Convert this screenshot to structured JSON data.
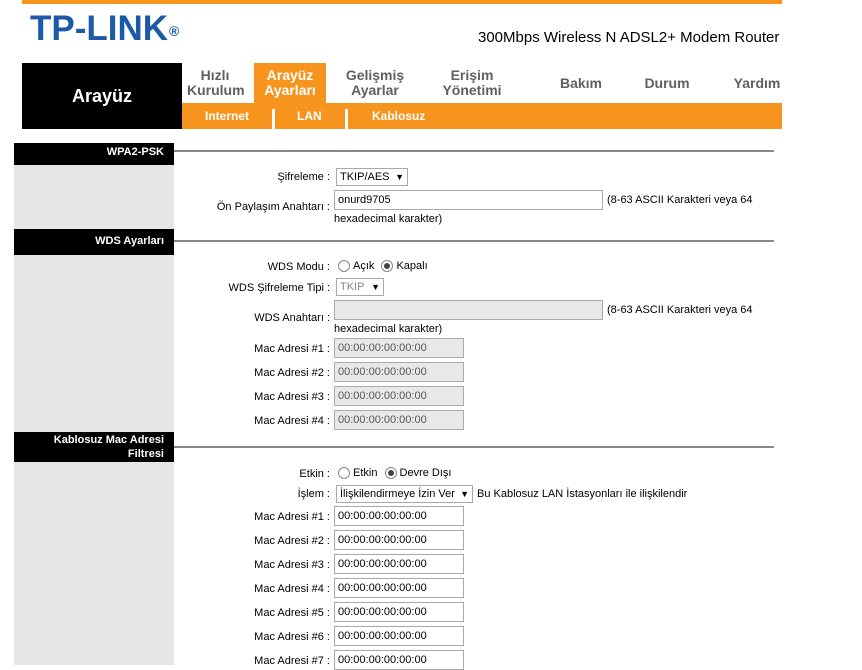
{
  "header": {
    "logo_text": "TP-LINK",
    "logo_reg": "®",
    "model": "300Mbps Wireless N ADSL2+ Modem Router",
    "accent_color": "#f7941d",
    "logo_color": "#1a5aa6"
  },
  "nav": {
    "section_title": "Arayüz",
    "items": [
      {
        "label": "Hızlı Kurulum"
      },
      {
        "label": "Arayüz Ayarları"
      },
      {
        "label": "Gelişmiş Ayarlar"
      },
      {
        "label": "Erişim Yönetimi"
      },
      {
        "label": "Bakım"
      },
      {
        "label": "Durum"
      },
      {
        "label": "Yardım"
      }
    ],
    "subitems": [
      {
        "label": "Internet"
      },
      {
        "label": "LAN"
      },
      {
        "label": "Kablosuz"
      }
    ]
  },
  "wpa": {
    "section": "WPA2-PSK",
    "encryption_label": "Şifreleme :",
    "encryption_value": "TKIP/AES",
    "psk_label": "Ön Paylaşım Anahtarı :",
    "psk_value": "onurd9705",
    "psk_note_line1": "(8-63 ASCII Karakteri veya 64",
    "psk_note_line2": "hexadecimal karakter)"
  },
  "wds": {
    "section": "WDS Ayarları",
    "mode_label": "WDS Modu :",
    "mode_on": "Açık",
    "mode_off": "Kapalı",
    "enc_label": "WDS Şifreleme Tipi :",
    "enc_value": "TKIP",
    "key_label": "WDS Anahtarı :",
    "key_value": "",
    "key_note_line1": "(8-63 ASCII Karakteri veya 64",
    "key_note_line2": "hexadecimal karakter)",
    "macs": [
      {
        "label": "Mac Adresi #1 :",
        "value": "00:00:00:00:00:00"
      },
      {
        "label": "Mac Adresi #2 :",
        "value": "00:00:00:00:00:00"
      },
      {
        "label": "Mac Adresi #3 :",
        "value": "00:00:00:00:00:00"
      },
      {
        "label": "Mac Adresi #4 :",
        "value": "00:00:00:00:00:00"
      }
    ]
  },
  "macfilter": {
    "section_line1": "Kablosuz Mac Adresi",
    "section_line2": "Filtresi",
    "active_label": "Etkin :",
    "active_on": "Etkin",
    "active_off": "Devre Dışı",
    "action_label": "İşlem :",
    "action_value": "İlişkilendirmeye İzin Ver",
    "action_note": "Bu Kablosuz LAN İstasyonları ile ilişkilendir",
    "macs": [
      {
        "label": "Mac Adresi #1 :",
        "value": "00:00:00:00:00:00"
      },
      {
        "label": "Mac Adresi #2 :",
        "value": "00:00:00:00:00:00"
      },
      {
        "label": "Mac Adresi #3 :",
        "value": "00:00:00:00:00:00"
      },
      {
        "label": "Mac Adresi #4 :",
        "value": "00:00:00:00:00:00"
      },
      {
        "label": "Mac Adresi #5 :",
        "value": "00:00:00:00:00:00"
      },
      {
        "label": "Mac Adresi #6 :",
        "value": "00:00:00:00:00:00"
      },
      {
        "label": "Mac Adresi #7 :",
        "value": "00:00:00:00:00:00"
      }
    ]
  }
}
